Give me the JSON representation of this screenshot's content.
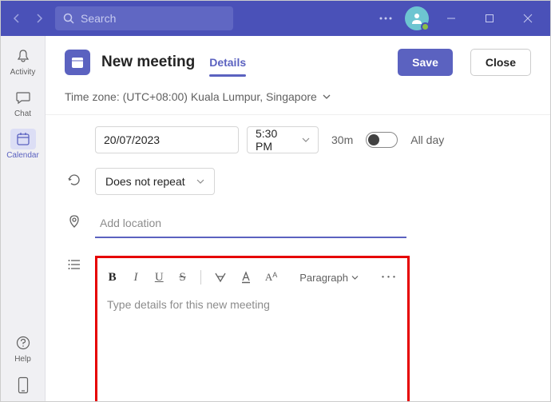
{
  "titlebar": {
    "search_placeholder": "Search"
  },
  "rail": {
    "items": [
      {
        "label": "Activity"
      },
      {
        "label": "Chat"
      },
      {
        "label": "Calendar"
      },
      {
        "label": "Help"
      }
    ]
  },
  "header": {
    "title": "New meeting",
    "tabs": [
      {
        "label": "Details"
      }
    ],
    "save_label": "Save",
    "close_label": "Close"
  },
  "timezone": {
    "label": "Time zone: (UTC+08:00) Kuala Lumpur, Singapore"
  },
  "form": {
    "date": "20/07/2023",
    "time": "5:30 PM",
    "duration": "30m",
    "all_day_label": "All day",
    "repeat_label": "Does not repeat",
    "location_placeholder": "Add location"
  },
  "editor": {
    "paragraph_label": "Paragraph",
    "placeholder": "Type details for this new meeting"
  }
}
